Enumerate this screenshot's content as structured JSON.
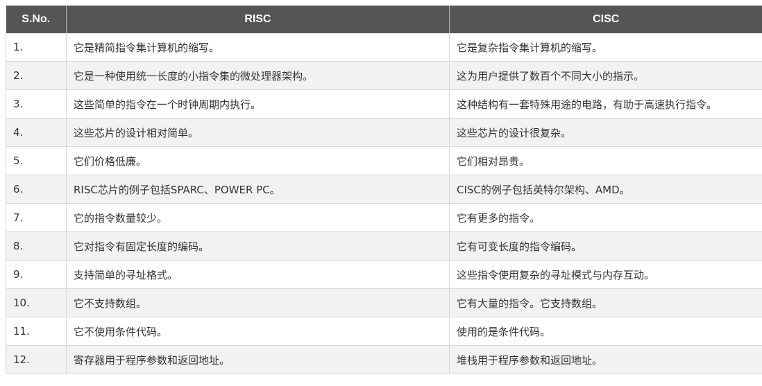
{
  "table": {
    "headers": [
      "S.No.",
      "RISC",
      "CISC"
    ],
    "rows": [
      [
        "1.",
        "它是精简指令集计算机的缩写。",
        "它是复杂指令集计算机的缩写。"
      ],
      [
        "2.",
        "它是一种使用统一长度的小指令集的微处理器架构。",
        "这为用户提供了数百个不同大小的指示。"
      ],
      [
        "3.",
        "这些简单的指令在一个时钟周期内执行。",
        "这种结构有一套特殊用途的电路，有助于高速执行指令。"
      ],
      [
        "4.",
        "这些芯片的设计相对简单。",
        "这些芯片的设计很复杂。"
      ],
      [
        "5.",
        "它们价格低廉。",
        "它们相对昂贵。"
      ],
      [
        "6.",
        "RISC芯片的例子包括SPARC、POWER PC。",
        "CISC的例子包括英特尔架构、AMD。"
      ],
      [
        "7.",
        "它的指令数量较少。",
        "它有更多的指令。"
      ],
      [
        "8.",
        "它对指令有固定长度的编码。",
        "它有可变长度的指令编码。"
      ],
      [
        "9.",
        "支持简单的寻址格式。",
        "这些指令使用复杂的寻址模式与内存互动。"
      ],
      [
        "10.",
        "它不支持数组。",
        "它有大量的指令。它支持数组。"
      ],
      [
        "11.",
        "它不使用条件代码。",
        "使用的是条件代码。"
      ],
      [
        "12.",
        "寄存器用于程序参数和返回地址。",
        "堆栈用于程序参数和返回地址。"
      ]
    ]
  }
}
